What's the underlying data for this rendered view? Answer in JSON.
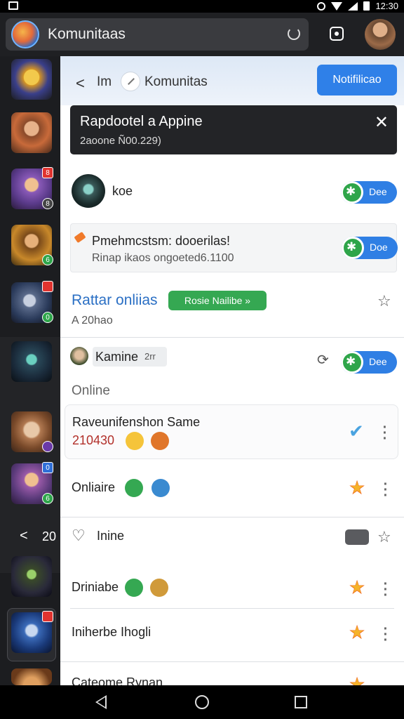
{
  "status_bar": {
    "time": "12:30"
  },
  "top_bar": {
    "title": "Komunitaas"
  },
  "rail": {
    "badges": [
      "",
      "8",
      "",
      "6",
      "0",
      "",
      "",
      "6",
      "",
      ""
    ],
    "top_badges": [
      "",
      "",
      "8",
      "",
      "",
      "",
      "",
      "0",
      "",
      ""
    ],
    "back_label": "<",
    "back_number": "20"
  },
  "panel_header": {
    "back": "<",
    "prefix": "Im",
    "title": "Komunitas",
    "notify_button": "Notifilicao"
  },
  "toast": {
    "title": "Rapdootel a Appine",
    "subtitle": "2aoone Ñ00.229)",
    "close": "✕"
  },
  "rows": {
    "user1": {
      "name": "koe",
      "toggle": "Dee"
    },
    "notice": {
      "title": "Pmehmcstsm: dooerilas!",
      "subtitle": "Rinap ikaos ongoeted6.1100",
      "toggle": "Doe"
    },
    "section": {
      "title": "Rattar onliias",
      "pill": "Rosie Nailibe »",
      "count": "A 20hao"
    },
    "user2": {
      "name": "Kamine",
      "tag": "2rr",
      "toggle": "Dee"
    },
    "online_header": "Online",
    "game": {
      "title": "Raveunifenshon Same",
      "number": "210430"
    },
    "onliaire": {
      "label": "Onliaire"
    },
    "inine": {
      "label": "Inine"
    },
    "driniabe": {
      "label": "Driniabe"
    },
    "iniherbe": {
      "label": "Iniherbe Ihogli"
    },
    "last": {
      "label": "Cateome Rynan"
    }
  },
  "colors": {
    "accent_blue": "#2f80e8",
    "toggle_green": "#2ea54a",
    "section_blue": "#2a6fc4",
    "badge_red": "#e0332f"
  }
}
